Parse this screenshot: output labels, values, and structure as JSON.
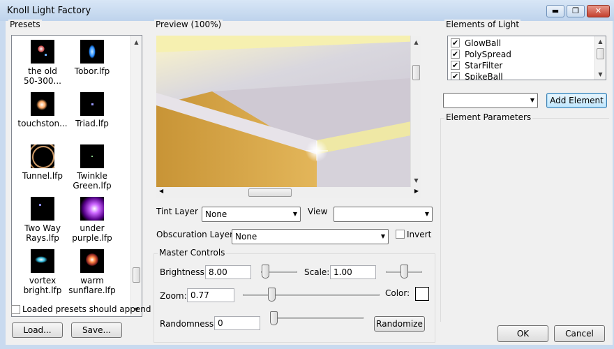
{
  "window": {
    "title": "Knoll Light Factory",
    "minimize": "▬",
    "maximize": "❐",
    "close": "✕"
  },
  "presets": {
    "label": "Presets",
    "items": [
      {
        "name": "the old\n50-300..."
      },
      {
        "name": "Tobor.lfp"
      },
      {
        "name": "touchston..."
      },
      {
        "name": "Triad.lfp"
      },
      {
        "name": "Tunnel.lfp"
      },
      {
        "name": "Twinkle\nGreen.lfp"
      },
      {
        "name": "Two Way\nRays.lfp"
      },
      {
        "name": "under\npurple.lfp"
      },
      {
        "name": "vortex\nbright.lfp"
      },
      {
        "name": "warm\nsunflare.lfp"
      }
    ],
    "append_label": "Loaded presets should append",
    "append_checked": false,
    "load_label": "Load...",
    "save_label": "Save..."
  },
  "preview": {
    "label": "Preview (100%)",
    "tint_label": "Tint Layer",
    "tint_value": "None",
    "view_label": "View",
    "view_value": "",
    "obscuration_label": "Obscuration Layer",
    "obscuration_value": "None",
    "invert_label": "Invert",
    "invert_checked": false
  },
  "master": {
    "label": "Master Controls",
    "brightness_label": "Brightness:",
    "brightness_value": "8.00",
    "scale_label": "Scale:",
    "scale_value": "1.00",
    "zoom_label": "Zoom:",
    "zoom_value": "0.77",
    "color_label": "Color:",
    "color_value": "#ffffff",
    "randomness_label": "Randomness:",
    "randomness_value": "0",
    "randomize_label": "Randomize"
  },
  "elements": {
    "label": "Elements of Light",
    "items": [
      {
        "name": "GlowBall",
        "checked": true
      },
      {
        "name": "PolySpread",
        "checked": true
      },
      {
        "name": "StarFilter",
        "checked": true
      },
      {
        "name": "SpikeBall",
        "checked": true
      }
    ],
    "add_label": "Add Element",
    "combo_value": "",
    "params_label": "Element Parameters"
  },
  "footer": {
    "ok_label": "OK",
    "cancel_label": "Cancel"
  }
}
